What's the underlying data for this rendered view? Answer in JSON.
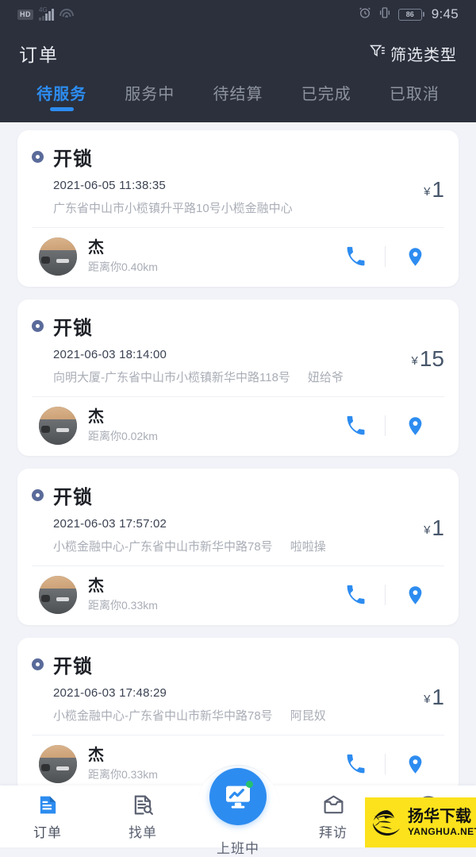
{
  "status_bar": {
    "hd_label": "HD",
    "network_label": "4G",
    "battery_level": "86",
    "time": "9:45"
  },
  "header": {
    "title": "订单",
    "filter_label": "筛选类型"
  },
  "tabs": [
    {
      "label": "待服务",
      "active": true
    },
    {
      "label": "服务中",
      "active": false
    },
    {
      "label": "待结算",
      "active": false
    },
    {
      "label": "已完成",
      "active": false
    },
    {
      "label": "已取消",
      "active": false
    }
  ],
  "orders": [
    {
      "title": "开锁",
      "time": "2021-06-05 11:38:35",
      "address": "广东省中山市小榄镇升平路10号小榄金融中心",
      "extra": "",
      "currency": "¥",
      "price": "1",
      "person_name": "杰",
      "distance": "距离你0.40km"
    },
    {
      "title": "开锁",
      "time": "2021-06-03 18:14:00",
      "address": "向明大厦-广东省中山市小榄镇新华中路118号",
      "extra": "妞给爷",
      "currency": "¥",
      "price": "15",
      "person_name": "杰",
      "distance": "距离你0.02km"
    },
    {
      "title": "开锁",
      "time": "2021-06-03 17:57:02",
      "address": "小榄金融中心-广东省中山市新华中路78号",
      "extra": "啦啦操",
      "currency": "¥",
      "price": "1",
      "person_name": "杰",
      "distance": "距离你0.33km"
    },
    {
      "title": "开锁",
      "time": "2021-06-03 17:48:29",
      "address": "小榄金融中心-广东省中山市新华中路78号",
      "extra": "阿昆奴",
      "currency": "¥",
      "price": "1",
      "person_name": "杰",
      "distance": "距离你0.33km"
    }
  ],
  "bottom_nav": [
    {
      "label": "订单",
      "icon": "order-document-icon",
      "active": true
    },
    {
      "label": "找单",
      "icon": "search-document-icon",
      "active": false
    },
    {
      "label": "上班中",
      "icon": "monitor-chart-icon",
      "active": false
    },
    {
      "label": "拜访",
      "icon": "inbox-tray-icon",
      "active": false
    },
    {
      "label": "",
      "icon": "chat-bubble-icon",
      "active": false
    }
  ],
  "watermark": {
    "cn": "扬华下载",
    "en": "YANGHUA.NET"
  },
  "colors": {
    "accent": "#2d8cf0",
    "topbar": "#2b303c",
    "page_bg": "#f2f3f8",
    "price": "#47566a",
    "watermark_bg": "#fbe21c"
  }
}
